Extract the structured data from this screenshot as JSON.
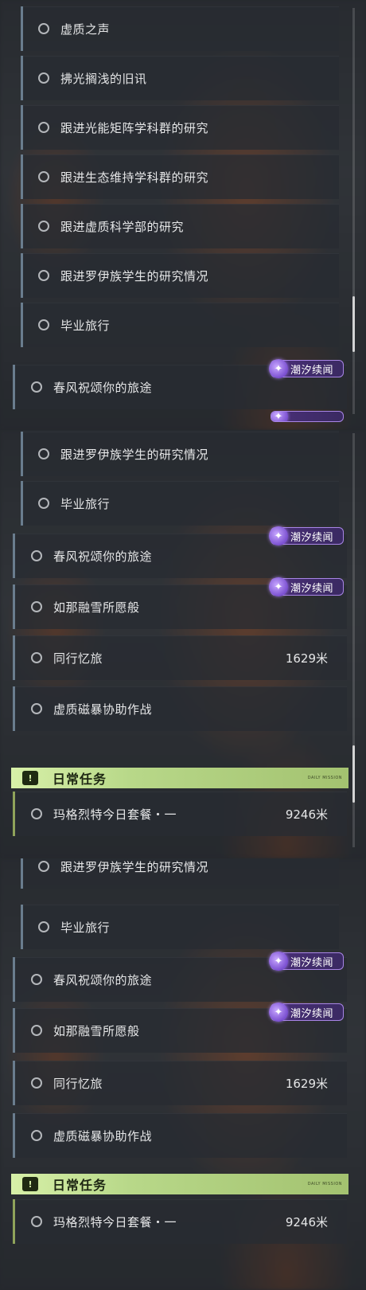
{
  "badge_text": "潮汐续闻",
  "daily_section": {
    "title": "日常任务",
    "subtitle": "DAILY MISSION"
  },
  "panel1": {
    "rows": [
      {
        "label": "虚质之声"
      },
      {
        "label": "拂光搁浅的旧讯"
      },
      {
        "label": "跟进光能矩阵学科群的研究"
      },
      {
        "label": "跟进生态维持学科群的研究"
      },
      {
        "label": "跟进虚质科学部的研究"
      },
      {
        "label": "跟进罗伊族学生的研究情况"
      },
      {
        "label": "毕业旅行"
      },
      {
        "label": "春风祝颂你的旅途"
      }
    ]
  },
  "panel2": {
    "rows": [
      {
        "label": "跟进罗伊族学生的研究情况"
      },
      {
        "label": "毕业旅行"
      },
      {
        "label": "春风祝颂你的旅途"
      },
      {
        "label": "如那融雪所愿般"
      },
      {
        "label": "同行忆旅",
        "distance": "1629米"
      },
      {
        "label": "虚质磁暴协助作战"
      }
    ],
    "daily_rows": [
      {
        "label": "玛格烈特今日套餐・一",
        "distance": "9246米"
      }
    ]
  },
  "panel3": {
    "rows": [
      {
        "label": "跟进罗伊族学生的研究情况"
      },
      {
        "label": "毕业旅行"
      },
      {
        "label": "春风祝颂你的旅途"
      },
      {
        "label": "如那融雪所愿般"
      },
      {
        "label": "同行忆旅",
        "distance": "1629米"
      },
      {
        "label": "虚质磁暴协助作战"
      }
    ],
    "daily_rows": [
      {
        "label": "玛格烈特今日套餐・一",
        "distance": "9246米"
      }
    ]
  },
  "colors": {
    "badge": "#4a2f78",
    "daily_header": "#b8d889",
    "row_bg": "#2a2e34"
  }
}
